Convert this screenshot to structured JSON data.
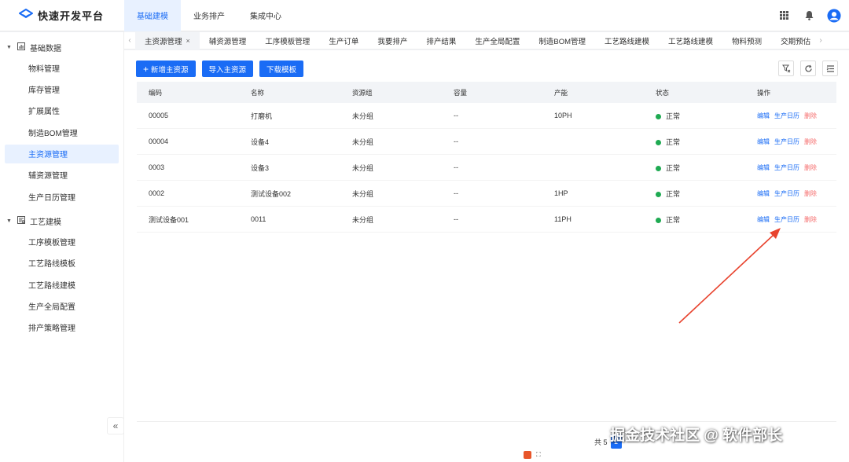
{
  "app": {
    "title": "快速开发平台"
  },
  "topnav": [
    {
      "label": "基础建模",
      "active": true
    },
    {
      "label": "业务排产",
      "active": false
    },
    {
      "label": "集成中心",
      "active": false
    }
  ],
  "header_icons": [
    "grid-icon",
    "bell-icon",
    "user-avatar-icon"
  ],
  "sidebar": {
    "groups": [
      {
        "title": "基础数据",
        "icon": "chart-icon",
        "items": [
          {
            "label": "物料管理"
          },
          {
            "label": "库存管理"
          },
          {
            "label": "扩展属性"
          },
          {
            "label": "制造BOM管理"
          },
          {
            "label": "主资源管理",
            "active": true
          },
          {
            "label": "辅资源管理"
          },
          {
            "label": "生产日历管理"
          }
        ]
      },
      {
        "title": "工艺建模",
        "icon": "process-icon",
        "items": [
          {
            "label": "工序模板管理"
          },
          {
            "label": "工艺路线模板"
          },
          {
            "label": "工艺路线建模"
          },
          {
            "label": "生产全局配置"
          },
          {
            "label": "排产策略管理"
          }
        ]
      }
    ],
    "collapse_label": "«"
  },
  "tabs": {
    "left_arrow": "‹",
    "right_arrow": "›",
    "items": [
      {
        "label": "主资源管理",
        "active": true,
        "close": "×"
      },
      {
        "label": "辅资源管理"
      },
      {
        "label": "工序模板管理"
      },
      {
        "label": "生产订单"
      },
      {
        "label": "我要排产"
      },
      {
        "label": "排产结果"
      },
      {
        "label": "生产全局配置"
      },
      {
        "label": "制造BOM管理"
      },
      {
        "label": "工艺路线建模"
      },
      {
        "label": "工艺路线建模"
      },
      {
        "label": "物料预测"
      },
      {
        "label": "交期预估"
      }
    ]
  },
  "toolbar": {
    "add_label": "新增主资源",
    "add_icon": "+",
    "import_label": "导入主资源",
    "download_label": "下载模板"
  },
  "table": {
    "columns": [
      "编码",
      "名称",
      "资源组",
      "容量",
      "产能",
      "状态",
      "操作"
    ],
    "rows": [
      {
        "code": "00005",
        "name": "打磨机",
        "group": "未分组",
        "capacity": "--",
        "output": "10PH",
        "status": "正常"
      },
      {
        "code": "00004",
        "name": "设备4",
        "group": "未分组",
        "capacity": "--",
        "output": "",
        "status": "正常"
      },
      {
        "code": "0003",
        "name": "设备3",
        "group": "未分组",
        "capacity": "--",
        "output": "",
        "status": "正常"
      },
      {
        "code": "0002",
        "name": "测试设备002",
        "group": "未分组",
        "capacity": "--",
        "output": "1HP",
        "status": "正常"
      },
      {
        "code": "测试设备001",
        "name": "0011",
        "group": "未分组",
        "capacity": "--",
        "output": "11PH",
        "status": "正常"
      }
    ],
    "ops": {
      "edit": "编辑",
      "calendar": "生产日历",
      "delete": "删除"
    }
  },
  "pager": {
    "total_prefix": "共 5",
    "current_page": "1"
  },
  "watermark": "掘金技术社区 @ 软件部长",
  "colors": {
    "primary": "#1a6cf5",
    "status_ok": "#1faa52",
    "danger": "#f56c6c",
    "arrow": "#e8432e"
  }
}
